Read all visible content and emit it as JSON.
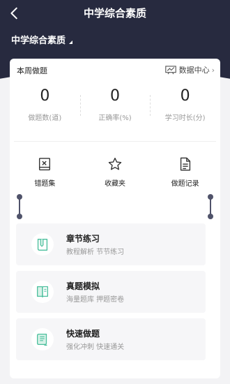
{
  "header": {
    "title": "中学综合素质",
    "back_icon": "chevron-left-icon",
    "subject_selector": "中学综合素质",
    "colors": {
      "header_bg": "#272a3f",
      "accent": "#4bbf9d"
    }
  },
  "weekly_card": {
    "title": "本周做题",
    "data_center_label": "数据中心",
    "stats": [
      {
        "value": "0",
        "label": "做题数(道)"
      },
      {
        "value": "0",
        "label": "正确率(%)"
      },
      {
        "value": "0",
        "label": "学习时长(分)"
      }
    ]
  },
  "tools": [
    {
      "label": "错题集",
      "icon": "wrong-book-icon"
    },
    {
      "label": "收藏夹",
      "icon": "star-icon"
    },
    {
      "label": "做题记录",
      "icon": "record-document-icon"
    }
  ],
  "sections": [
    {
      "title": "章节练习",
      "subtitle": "教程解析 节节练习",
      "icon": "pen-book-icon"
    },
    {
      "title": "真题模拟",
      "subtitle": "海量题库 押题密卷",
      "icon": "exam-book-icon"
    },
    {
      "title": "快速做题",
      "subtitle": "强化冲刺 快速通关",
      "icon": "scroll-icon"
    }
  ]
}
